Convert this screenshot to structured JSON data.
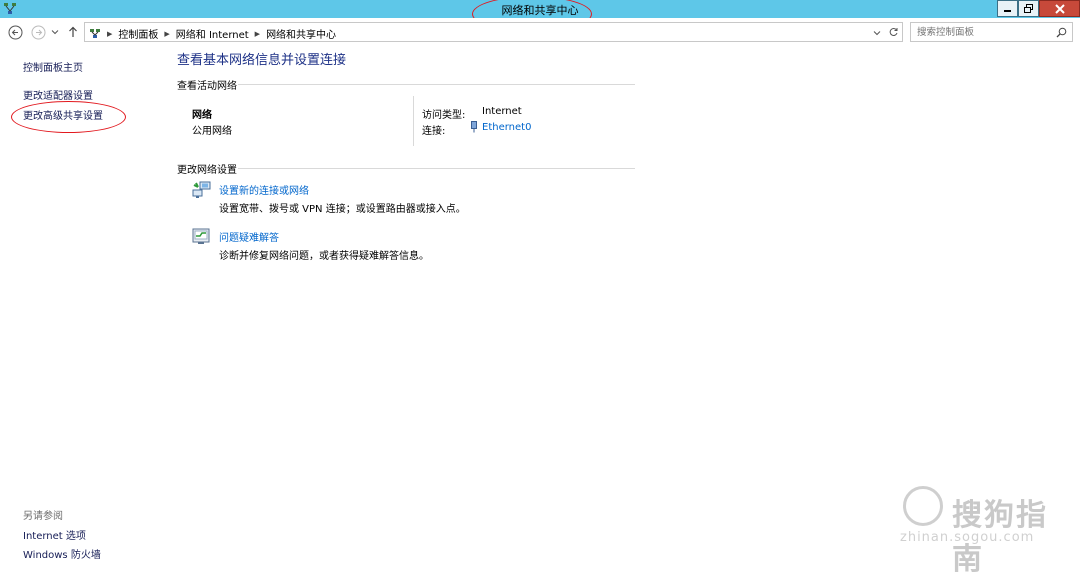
{
  "window": {
    "title": "网络和共享中心"
  },
  "address_bar": {
    "breadcrumbs": [
      "控制面板",
      "网络和 Internet",
      "网络和共享中心"
    ],
    "search_placeholder": "搜索控制面板"
  },
  "sidebar": {
    "home": "控制面板主页",
    "links": [
      "更改适配器设置",
      "更改高级共享设置"
    ],
    "see_also_label": "另请参阅",
    "see_also": [
      "Internet 选项",
      "Windows 防火墙"
    ]
  },
  "main": {
    "title": "查看基本网络信息并设置连接",
    "active_networks_heading": "查看活动网络",
    "network": {
      "name": "网络",
      "type": "公用网络",
      "access_type_label": "访问类型:",
      "access_type_value": "Internet",
      "connection_label": "连接:",
      "connection_value": "Ethernet0"
    },
    "change_settings_heading": "更改网络设置",
    "tasks": [
      {
        "title": "设置新的连接或网络",
        "desc": "设置宽带、拨号或 VPN 连接；或设置路由器或接入点。",
        "icon": "network-setup-icon"
      },
      {
        "title": "问题疑难解答",
        "desc": "诊断并修复网络问题，或者获得疑难解答信息。",
        "icon": "troubleshoot-icon"
      }
    ]
  },
  "watermark": {
    "text": "搜狗指南",
    "url": "zhinan.sogou.com"
  },
  "colors": {
    "titlebar": "#5ec7e8",
    "link": "#0066cc",
    "heading": "#1e3287",
    "annotation": "#e2191f",
    "close_button": "#c7493a"
  }
}
